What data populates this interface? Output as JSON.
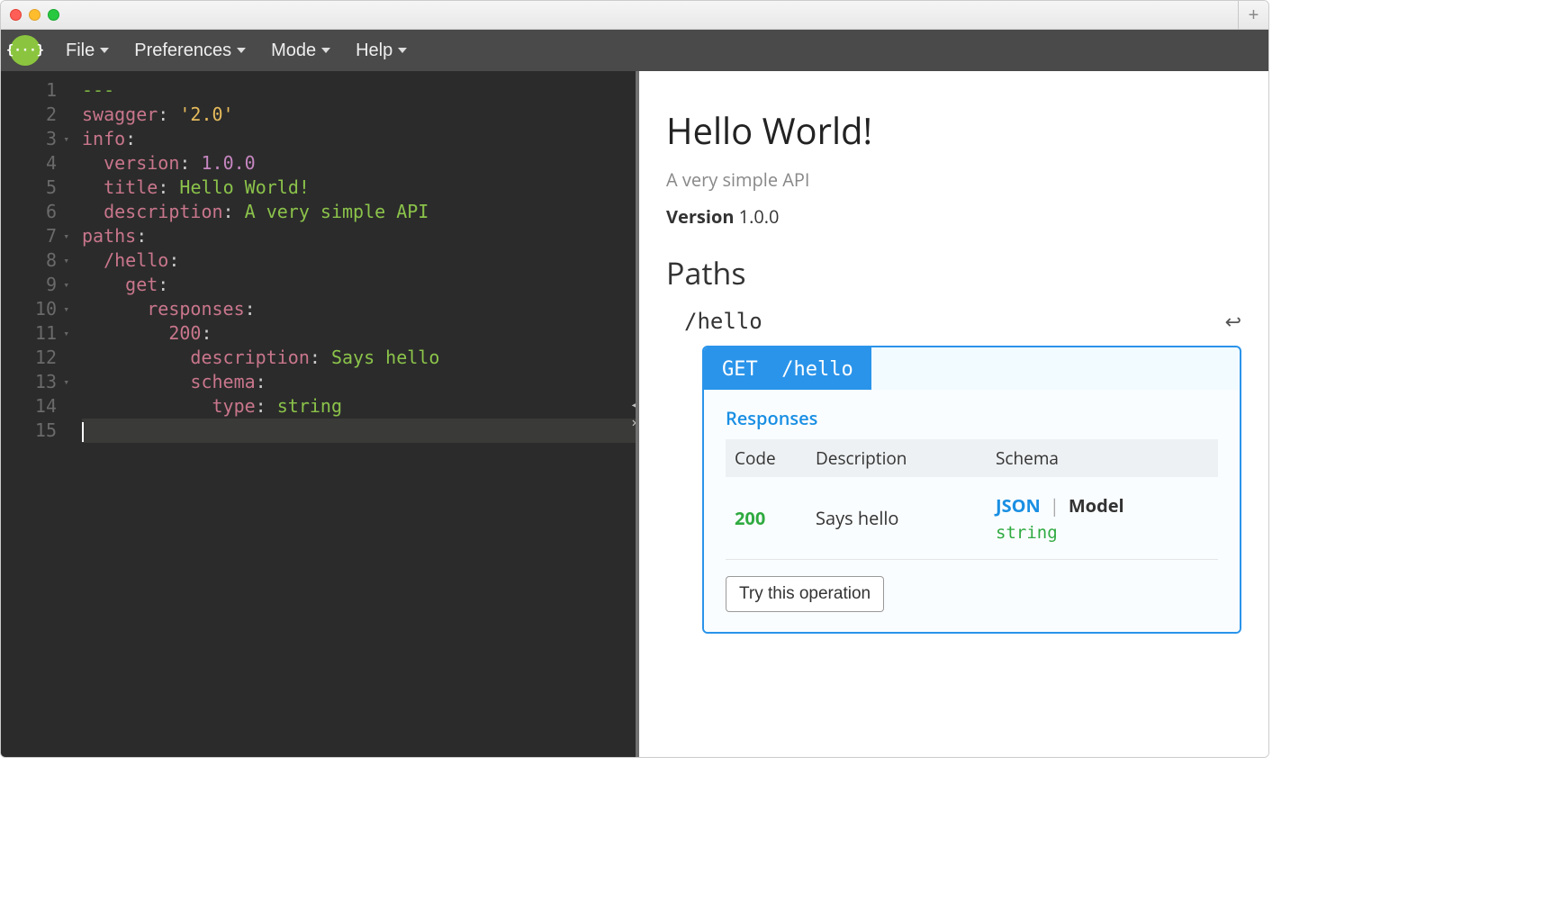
{
  "menu": {
    "file": "File",
    "prefs": "Preferences",
    "mode": "Mode",
    "help": "Help"
  },
  "editor": {
    "lines": [
      {
        "n": 1,
        "fold": false,
        "tokens": [
          [
            "dash",
            "---"
          ]
        ]
      },
      {
        "n": 2,
        "fold": false,
        "tokens": [
          [
            "key",
            "swagger"
          ],
          [
            "p",
            ": "
          ],
          [
            "str",
            "'2.0'"
          ]
        ]
      },
      {
        "n": 3,
        "fold": true,
        "tokens": [
          [
            "key",
            "info"
          ],
          [
            "p",
            ":"
          ]
        ]
      },
      {
        "n": 4,
        "fold": false,
        "tokens": [
          [
            "p",
            "  "
          ],
          [
            "key",
            "version"
          ],
          [
            "p",
            ": "
          ],
          [
            "num",
            "1.0.0"
          ]
        ]
      },
      {
        "n": 5,
        "fold": false,
        "tokens": [
          [
            "p",
            "  "
          ],
          [
            "key",
            "title"
          ],
          [
            "p",
            ": "
          ],
          [
            "val",
            "Hello World!"
          ]
        ]
      },
      {
        "n": 6,
        "fold": false,
        "tokens": [
          [
            "p",
            "  "
          ],
          [
            "key",
            "description"
          ],
          [
            "p",
            ": "
          ],
          [
            "val",
            "A very simple API"
          ]
        ]
      },
      {
        "n": 7,
        "fold": true,
        "tokens": [
          [
            "key",
            "paths"
          ],
          [
            "p",
            ":"
          ]
        ]
      },
      {
        "n": 8,
        "fold": true,
        "tokens": [
          [
            "p",
            "  "
          ],
          [
            "key",
            "/hello"
          ],
          [
            "p",
            ":"
          ]
        ]
      },
      {
        "n": 9,
        "fold": true,
        "tokens": [
          [
            "p",
            "    "
          ],
          [
            "key",
            "get"
          ],
          [
            "p",
            ":"
          ]
        ]
      },
      {
        "n": 10,
        "fold": true,
        "tokens": [
          [
            "p",
            "      "
          ],
          [
            "key",
            "responses"
          ],
          [
            "p",
            ":"
          ]
        ]
      },
      {
        "n": 11,
        "fold": true,
        "tokens": [
          [
            "p",
            "        "
          ],
          [
            "key",
            "200"
          ],
          [
            "p",
            ":"
          ]
        ]
      },
      {
        "n": 12,
        "fold": false,
        "tokens": [
          [
            "p",
            "          "
          ],
          [
            "key",
            "description"
          ],
          [
            "p",
            ": "
          ],
          [
            "val",
            "Says hello"
          ]
        ]
      },
      {
        "n": 13,
        "fold": true,
        "tokens": [
          [
            "p",
            "          "
          ],
          [
            "key",
            "schema"
          ],
          [
            "p",
            ":"
          ]
        ]
      },
      {
        "n": 14,
        "fold": false,
        "tokens": [
          [
            "p",
            "            "
          ],
          [
            "key",
            "type"
          ],
          [
            "p",
            ": "
          ],
          [
            "val",
            "string"
          ]
        ]
      },
      {
        "n": 15,
        "fold": false,
        "active": true,
        "tokens": []
      }
    ]
  },
  "preview": {
    "title": "Hello World!",
    "description": "A very simple API",
    "version_label": "Version",
    "version_value": "1.0.0",
    "paths_heading": "Paths",
    "path": "/hello",
    "op_method": "GET",
    "op_path": "/hello",
    "responses_label": "Responses",
    "col_code": "Code",
    "col_desc": "Description",
    "col_schema": "Schema",
    "resp_code": "200",
    "resp_desc": "Says hello",
    "schema_json": "JSON",
    "schema_model": "Model",
    "schema_value": "string",
    "try_label": "Try this operation"
  }
}
